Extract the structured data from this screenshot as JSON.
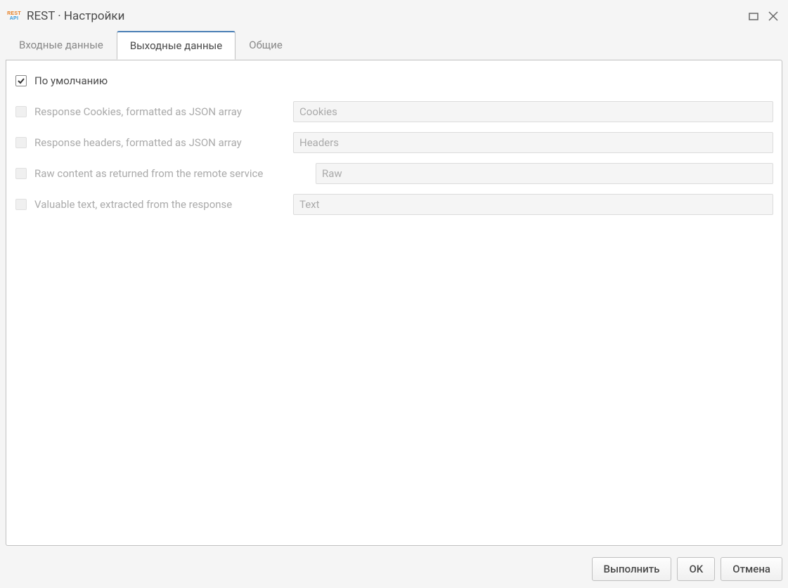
{
  "window": {
    "title": "REST · Настройки"
  },
  "tabs": {
    "input": "Входные данные",
    "output": "Выходные данные",
    "general": "Общие",
    "active": "output"
  },
  "form": {
    "default": {
      "label": "По умолчанию",
      "checked": true
    },
    "rows": [
      {
        "label": "Response Cookies, formatted as JSON array",
        "value": "Cookies",
        "checked": false,
        "disabled": true
      },
      {
        "label": "Response headers, formatted as JSON array",
        "value": "Headers",
        "checked": false,
        "disabled": true
      },
      {
        "label": "Raw content as returned from the remote service",
        "value": "Raw",
        "checked": false,
        "disabled": true
      },
      {
        "label": "Valuable text, extracted from the response",
        "value": "Text",
        "checked": false,
        "disabled": true
      }
    ]
  },
  "buttons": {
    "execute": "Выполнить",
    "ok": "OK",
    "cancel": "Отмена"
  }
}
